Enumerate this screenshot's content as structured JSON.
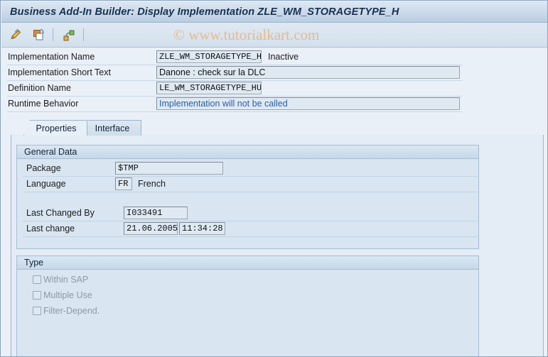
{
  "window": {
    "title": "Business Add-In Builder: Display Implementation ZLE_WM_STORAGETYPE_H"
  },
  "toolbar": {
    "icons": [
      {
        "name": "edit-pencil-icon",
        "label": "Display <-> Change"
      },
      {
        "name": "copy-object-icon",
        "label": "Other Implementation"
      },
      {
        "name": "hierarchy-icon",
        "label": "Definition Documentation"
      }
    ]
  },
  "watermark": {
    "text": "© www.tutorialkart.com"
  },
  "header": {
    "fields": [
      {
        "label": "Implementation Name",
        "value": "ZLE_WM_STORAGETYPE_H",
        "status": "Inactive"
      },
      {
        "label": "Implementation Short Text",
        "value": "Danone : check sur la DLC",
        "status": ""
      },
      {
        "label": "Definition Name",
        "value": "LE_WM_STORAGETYPE_HU",
        "status": ""
      },
      {
        "label": "Runtime Behavior",
        "value": "Implementation will not be called",
        "status": ""
      }
    ]
  },
  "tabs": [
    {
      "label": "Properties",
      "active": true
    },
    {
      "label": "Interface",
      "active": false
    }
  ],
  "general_data": {
    "title": "General Data",
    "package": {
      "label": "Package",
      "value": "$TMP"
    },
    "language": {
      "label": "Language",
      "value": "FR",
      "text": "French"
    },
    "last_changed_by": {
      "label": "Last Changed By",
      "value": "I033491"
    },
    "last_change": {
      "label": "Last change",
      "date": "21.06.2005",
      "time": "11:34:28"
    }
  },
  "type_section": {
    "title": "Type",
    "options": [
      {
        "label": "Within SAP",
        "checked": false
      },
      {
        "label": "Multiple Use",
        "checked": false
      },
      {
        "label": "Filter-Depend.",
        "checked": false
      }
    ]
  },
  "colors": {
    "title_text": "#19314f",
    "watermark": "#e8b98a",
    "runtime_text": "#2a5fa8",
    "disabled_label": "#8d9aa7",
    "panel_bg": "#d9e5f1",
    "window_bg": "#eaf0f7"
  }
}
